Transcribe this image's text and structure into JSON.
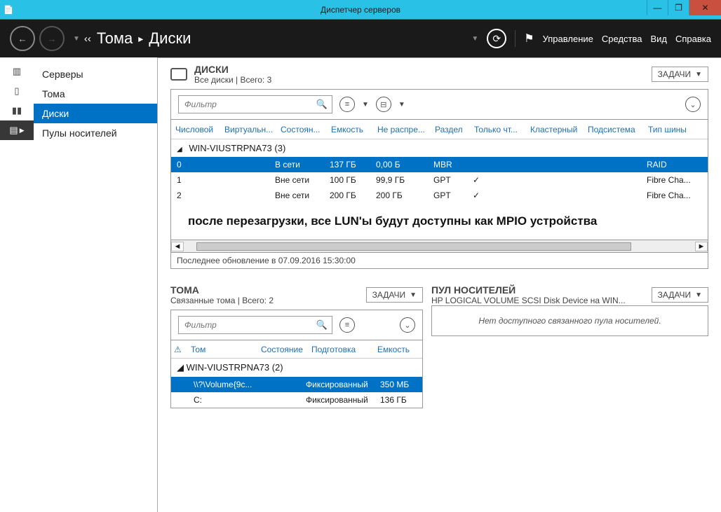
{
  "window": {
    "title": "Диспетчер серверов"
  },
  "breadcrumb": {
    "back_prefix": "‹‹",
    "level1": "Тома",
    "sep": "▸",
    "level2": "Диски"
  },
  "menu": {
    "manage": "Управление",
    "tools": "Средства",
    "view": "Вид",
    "help": "Справка"
  },
  "sidebar": {
    "items": [
      {
        "label": "Серверы"
      },
      {
        "label": "Тома"
      },
      {
        "label": "Диски"
      },
      {
        "label": "Пулы носителей"
      }
    ]
  },
  "disks_panel": {
    "title": "ДИСКИ",
    "subtitle": "Все диски | Всего: 3",
    "tasks_label": "ЗАДАЧИ",
    "filter_placeholder": "Фильтр",
    "columns": [
      "Числовой",
      "Виртуальн...",
      "Состоян...",
      "Емкость",
      "Не распре...",
      "Раздел",
      "Только чт...",
      "Кластерный",
      "Подсистема",
      "Тип шины"
    ],
    "group": "WIN-VIUSTRPNA73 (3)",
    "rows": [
      {
        "num": "0",
        "state": "В сети",
        "cap": "137 ГБ",
        "free": "0,00 Б",
        "part": "MBR",
        "ro": "",
        "bus": "RAID",
        "selected": true
      },
      {
        "num": "1",
        "state": "Вне сети",
        "cap": "100 ГБ",
        "free": "99,9 ГБ",
        "part": "GPT",
        "ro": "✓",
        "bus": "Fibre Cha..."
      },
      {
        "num": "2",
        "state": "Вне сети",
        "cap": "200 ГБ",
        "free": "200 ГБ",
        "part": "GPT",
        "ro": "✓",
        "bus": "Fibre Cha..."
      }
    ],
    "annotation": "после перезагрузки, все LUN'ы будут доступны как MPIO устройства",
    "status": "Последнее обновление в 07.09.2016 15:30:00"
  },
  "volumes_panel": {
    "title": "ТОМА",
    "subtitle": "Связанные тома | Всего: 2",
    "tasks_label": "ЗАДАЧИ",
    "filter_placeholder": "Фильтр",
    "columns": {
      "warn": "⚠",
      "tom": "Том",
      "state": "Состояние",
      "prep": "Подготовка",
      "cap": "Емкость"
    },
    "group": "WIN-VIUSTRPNA73 (2)",
    "rows": [
      {
        "tom": "\\\\?\\Volume{9c...",
        "prep": "Фиксированный",
        "cap": "350 МБ",
        "selected": true
      },
      {
        "tom": "C:",
        "prep": "Фиксированный",
        "cap": "136 ГБ"
      }
    ]
  },
  "pool_panel": {
    "title": "ПУЛ НОСИТЕЛЕЙ",
    "subtitle": "HP LOGICAL VOLUME SCSI Disk Device на WIN...",
    "tasks_label": "ЗАДАЧИ",
    "empty": "Нет доступного связанного пула носителей."
  }
}
